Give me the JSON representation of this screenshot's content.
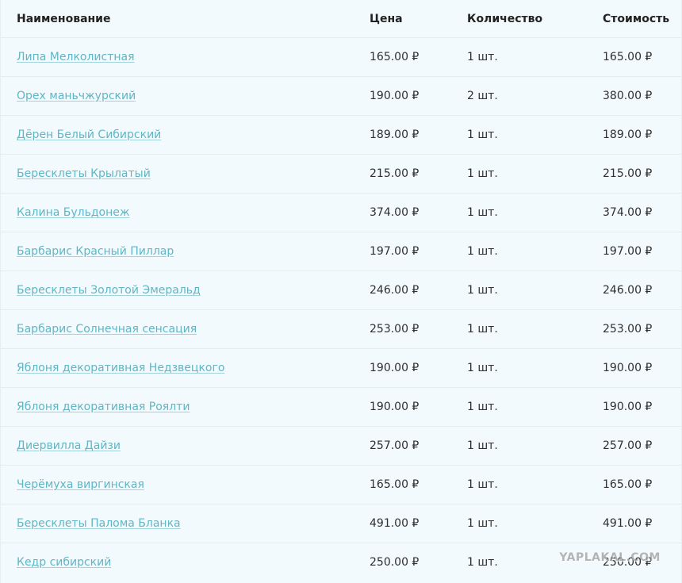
{
  "table": {
    "headers": {
      "name": "Наименование",
      "price": "Цена",
      "quantity": "Количество",
      "total": "Стоимость"
    },
    "rows": [
      {
        "name": "Липа Мелколистная",
        "price": "165.00 ₽",
        "quantity": "1 шт.",
        "total": "165.00 ₽"
      },
      {
        "name": "Орех маньчжурский",
        "price": "190.00 ₽",
        "quantity": "2 шт.",
        "total": "380.00 ₽"
      },
      {
        "name": "Дёрен Белый Сибирский",
        "price": "189.00 ₽",
        "quantity": "1 шт.",
        "total": "189.00 ₽"
      },
      {
        "name": "Бересклеты Крылатый",
        "price": "215.00 ₽",
        "quantity": "1 шт.",
        "total": "215.00 ₽"
      },
      {
        "name": "Калина Бульдонеж",
        "price": "374.00 ₽",
        "quantity": "1 шт.",
        "total": "374.00 ₽"
      },
      {
        "name": "Барбарис Красный Пиллар",
        "price": "197.00 ₽",
        "quantity": "1 шт.",
        "total": "197.00 ₽"
      },
      {
        "name": "Бересклеты Золотой Эмеральд",
        "price": "246.00 ₽",
        "quantity": "1 шт.",
        "total": "246.00 ₽"
      },
      {
        "name": "Барбарис Солнечная сенсация",
        "price": "253.00 ₽",
        "quantity": "1 шт.",
        "total": "253.00 ₽"
      },
      {
        "name": "Яблоня декоративная Недзвецкого",
        "price": "190.00 ₽",
        "quantity": "1 шт.",
        "total": "190.00 ₽"
      },
      {
        "name": "Яблоня декоративная Роялти",
        "price": "190.00 ₽",
        "quantity": "1 шт.",
        "total": "190.00 ₽"
      },
      {
        "name": "Диервилла Дайзи",
        "price": "257.00 ₽",
        "quantity": "1 шт.",
        "total": "257.00 ₽"
      },
      {
        "name": "Черёмуха виргинская",
        "price": "165.00 ₽",
        "quantity": "1 шт.",
        "total": "165.00 ₽"
      },
      {
        "name": "Бересклеты Палома Бланка",
        "price": "491.00 ₽",
        "quantity": "1 шт.",
        "total": "491.00 ₽"
      },
      {
        "name": "Кедр сибирский",
        "price": "250.00 ₽",
        "quantity": "1 шт.",
        "total": "250.00 ₽"
      }
    ]
  },
  "watermark": "YAPLAKAL.COM",
  "colors": {
    "background": "#f3fafd",
    "link": "#5fb6c5",
    "text": "#2f2f2f",
    "header_text": "#222222",
    "divider": "#e3ecef"
  }
}
